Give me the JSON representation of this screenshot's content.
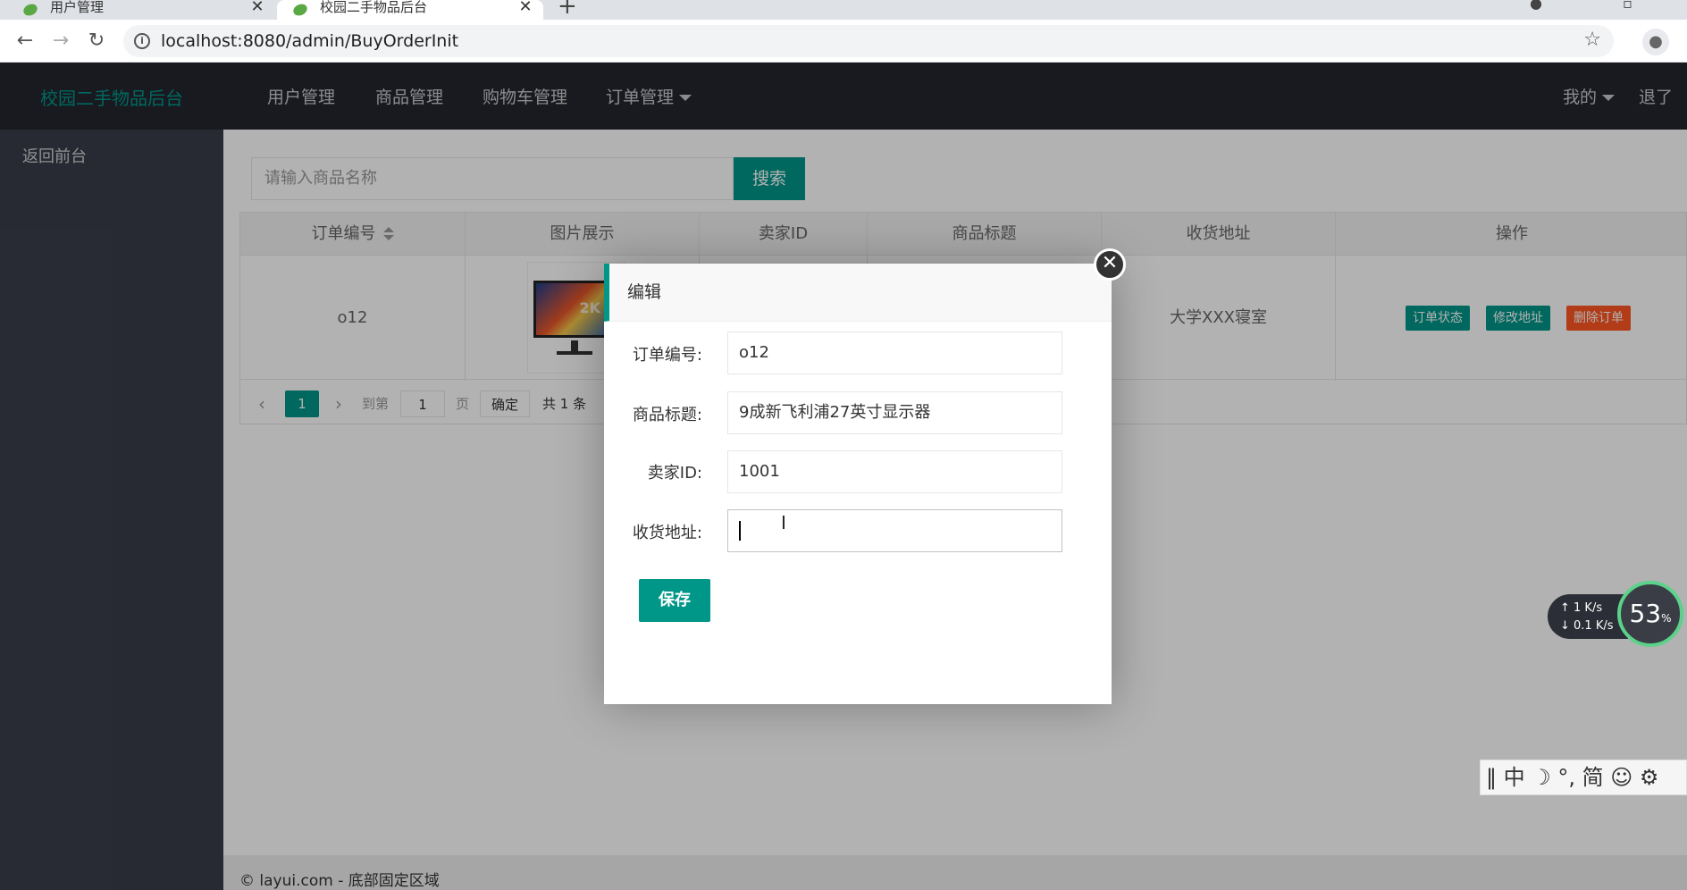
{
  "browser": {
    "tabs": [
      {
        "title": "用户管理",
        "close": "✕"
      },
      {
        "title": "校园二手物品后台",
        "close": "✕"
      }
    ],
    "new_tab": "+",
    "url": "localhost:8080/admin/BuyOrderInit"
  },
  "header": {
    "logo": "校园二手物品后台",
    "nav": [
      "用户管理",
      "商品管理",
      "购物车管理",
      "订单管理"
    ],
    "user_menu": "我的",
    "logout": "退了"
  },
  "sidebar": {
    "items": [
      "返回前台"
    ]
  },
  "search": {
    "placeholder": "请输入商品名称",
    "button": "搜索"
  },
  "table": {
    "headers": [
      "订单编号",
      "图片展示",
      "卖家ID",
      "商品标题",
      "收货地址",
      "操作"
    ],
    "row": {
      "order_no": "o12",
      "address": "大学XXX寝室",
      "image_badge": "2K"
    },
    "actions": [
      {
        "label": "订单状态",
        "color": "#009688"
      },
      {
        "label": "修改地址",
        "color": "#009688"
      },
      {
        "label": "删除订单",
        "color": "#FF5722"
      }
    ]
  },
  "pager": {
    "prev": "‹",
    "current": "1",
    "next": "›",
    "goto": "到第",
    "page_value": "1",
    "page_unit": "页",
    "confirm": "确定",
    "total": "共 1 条"
  },
  "footer": {
    "text": "© layui.com - 底部固定区域"
  },
  "modal": {
    "title": "编辑",
    "close": "✕",
    "fields": [
      {
        "label": "订单编号:",
        "value": "o12"
      },
      {
        "label": "商品标题:",
        "value": "9成新飞利浦27英寸显示器"
      },
      {
        "label": "卖家ID:",
        "value": "1001"
      },
      {
        "label": "收货地址:",
        "value": ""
      }
    ],
    "save": "保存"
  },
  "widgets": {
    "upload": "↑ 1 K/s",
    "download": "↓ 0.1 K/s",
    "percent": "53",
    "percent_unit": "%",
    "ime": "‖ 中 ☽ °, 简 ☺ ⚙"
  },
  "colors": {
    "accent": "#009688",
    "danger": "#FF5722",
    "header": "#23262e",
    "sidebar": "#393d49"
  }
}
